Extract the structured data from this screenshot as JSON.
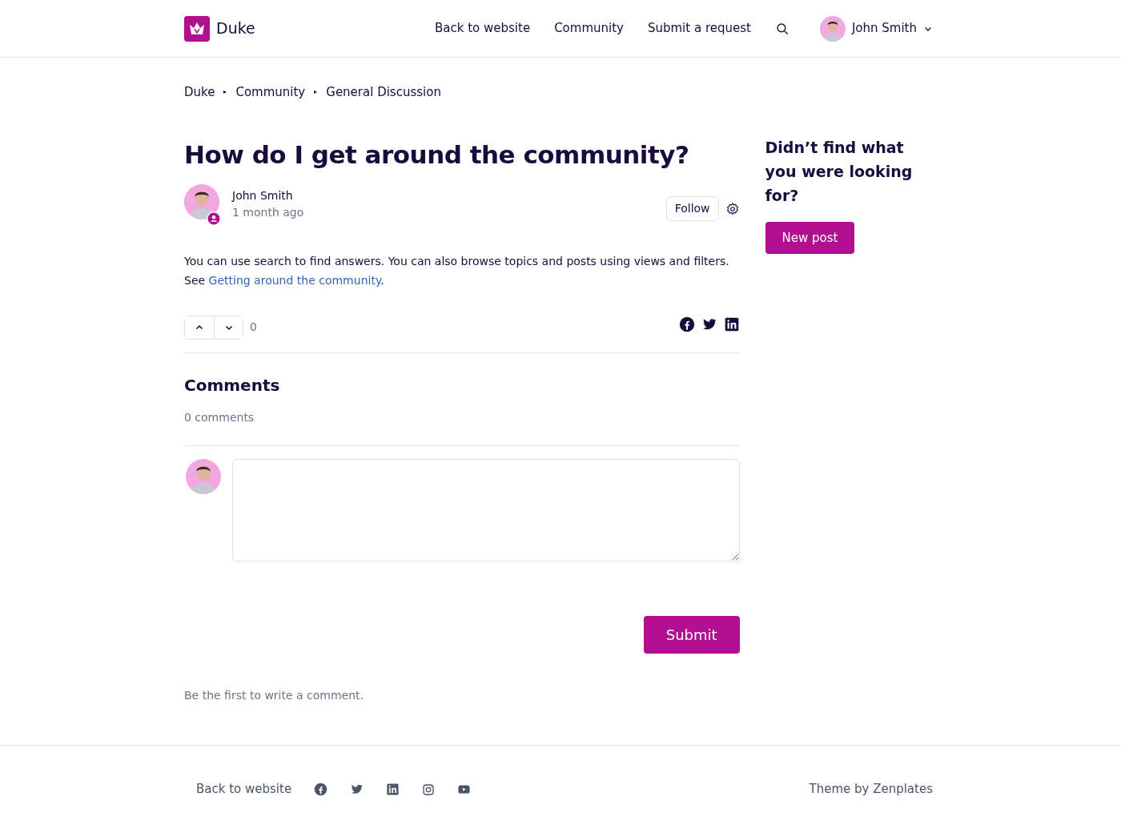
{
  "header": {
    "brand": "Duke",
    "nav": [
      "Back to website",
      "Community",
      "Submit a request"
    ],
    "user": "John Smith"
  },
  "breadcrumbs": [
    "Duke",
    "Community",
    "General Discussion"
  ],
  "post": {
    "title": "How do I get around the community?",
    "author": "John Smith",
    "time": "1 month ago",
    "follow": "Follow",
    "body_start": "You can use search to find answers. You can also browse topics and posts using views and filters. See ",
    "link": "Getting around the community",
    "body_end": ".",
    "votes": "0"
  },
  "comments": {
    "title": "Comments",
    "count": "0 comments",
    "submit": "Submit",
    "empty": "Be the first to write a comment."
  },
  "sidebar": {
    "title": "Didn’t find what you were looking for?",
    "button": "New post"
  },
  "footer": {
    "link": "Back to website",
    "credit": "Theme by Zenplates"
  }
}
